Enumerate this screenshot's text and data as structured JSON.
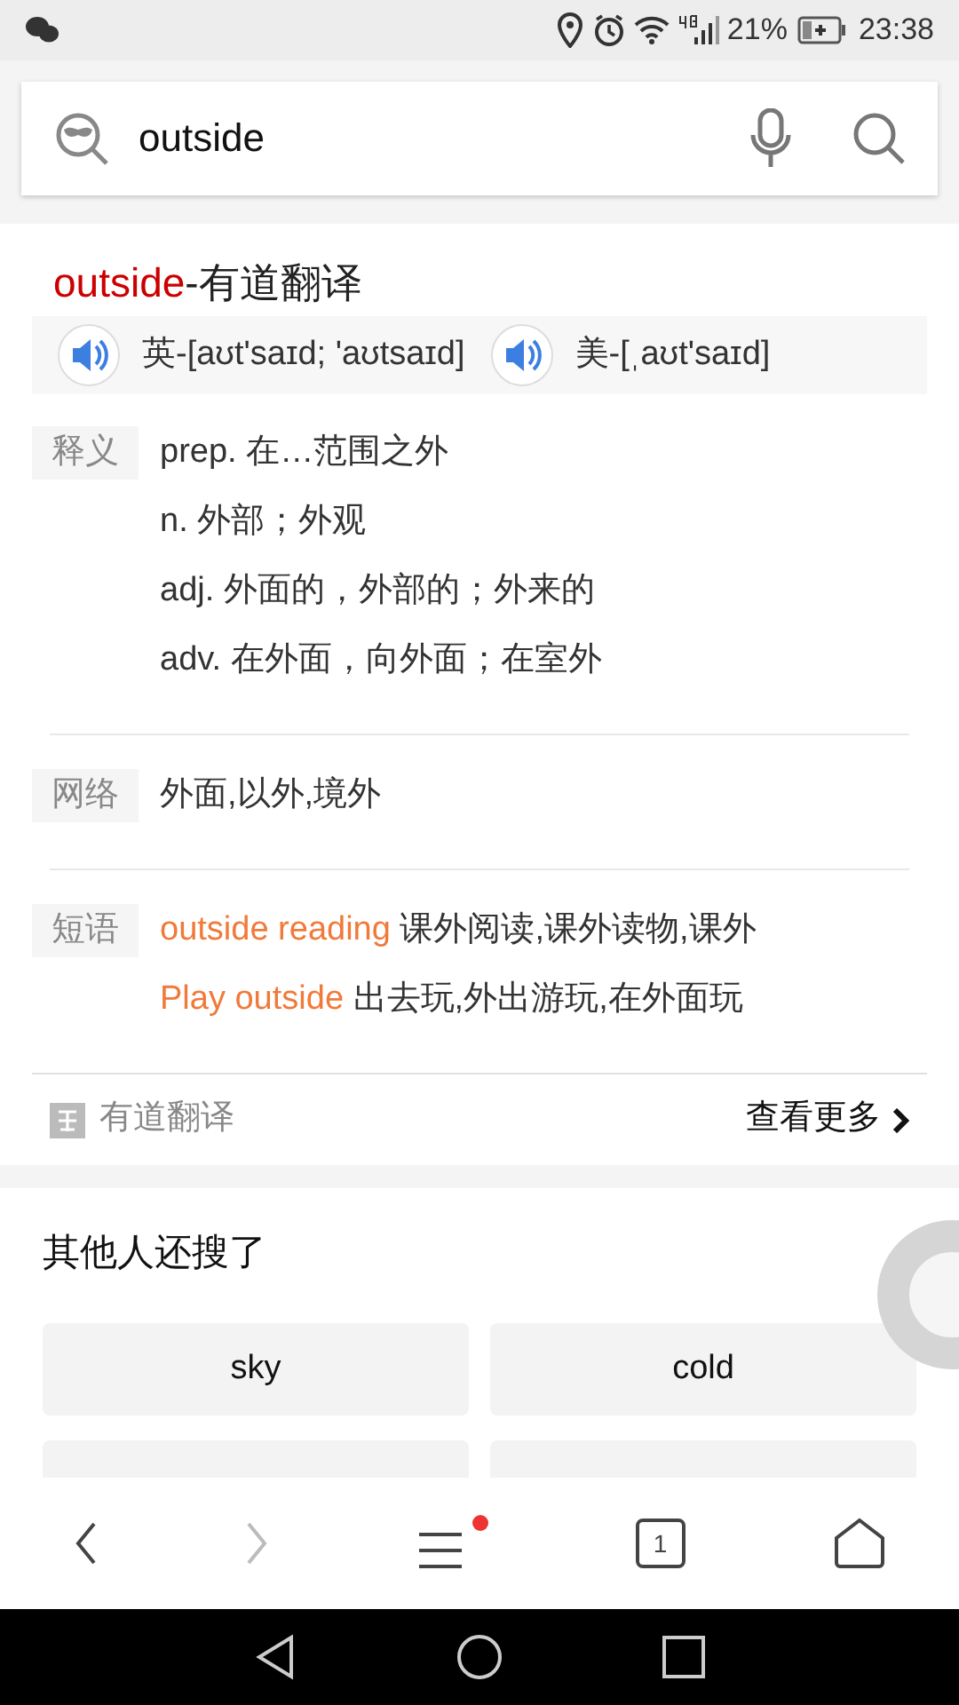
{
  "status_bar": {
    "battery": "21%",
    "time": "23:38"
  },
  "search": {
    "value": "outside"
  },
  "result": {
    "word": "outside",
    "source": "-有道翻译",
    "pronunciations": [
      {
        "text": "英-[aʊt'saɪd; 'aʊtsaɪd]"
      },
      {
        "text": "美-[ˌaʊt'saɪd]"
      }
    ],
    "sections": [
      {
        "label": "释义",
        "kind": "plain",
        "lines": [
          {
            "text": "prep. 在…范围之外"
          },
          {
            "text": "n. 外部；外观"
          },
          {
            "text": "adj. 外面的，外部的；外来的"
          },
          {
            "text": "adv. 在外面，向外面；在室外"
          }
        ]
      },
      {
        "label": "网络",
        "kind": "plain",
        "lines": [
          {
            "text": "外面,以外,境外"
          }
        ]
      },
      {
        "label": "短语",
        "kind": "phrase",
        "lines": [
          {
            "phrase": "outside reading",
            "text": "课外阅读,课外读物,课外"
          },
          {
            "phrase": "Play outside",
            "text": "出去玩,外出游玩,在外面玩"
          }
        ]
      }
    ],
    "footer": {
      "source": "有道翻译",
      "more": "查看更多"
    }
  },
  "related": {
    "title": "其他人还搜了",
    "items": [
      {
        "kind": "chip",
        "label": "sky"
      },
      {
        "kind": "chip",
        "label": "cold"
      },
      {
        "kind": "cut"
      },
      {
        "kind": "cut"
      }
    ]
  },
  "bottom_nav": {
    "menu_badge": true,
    "tab_count": "1"
  }
}
